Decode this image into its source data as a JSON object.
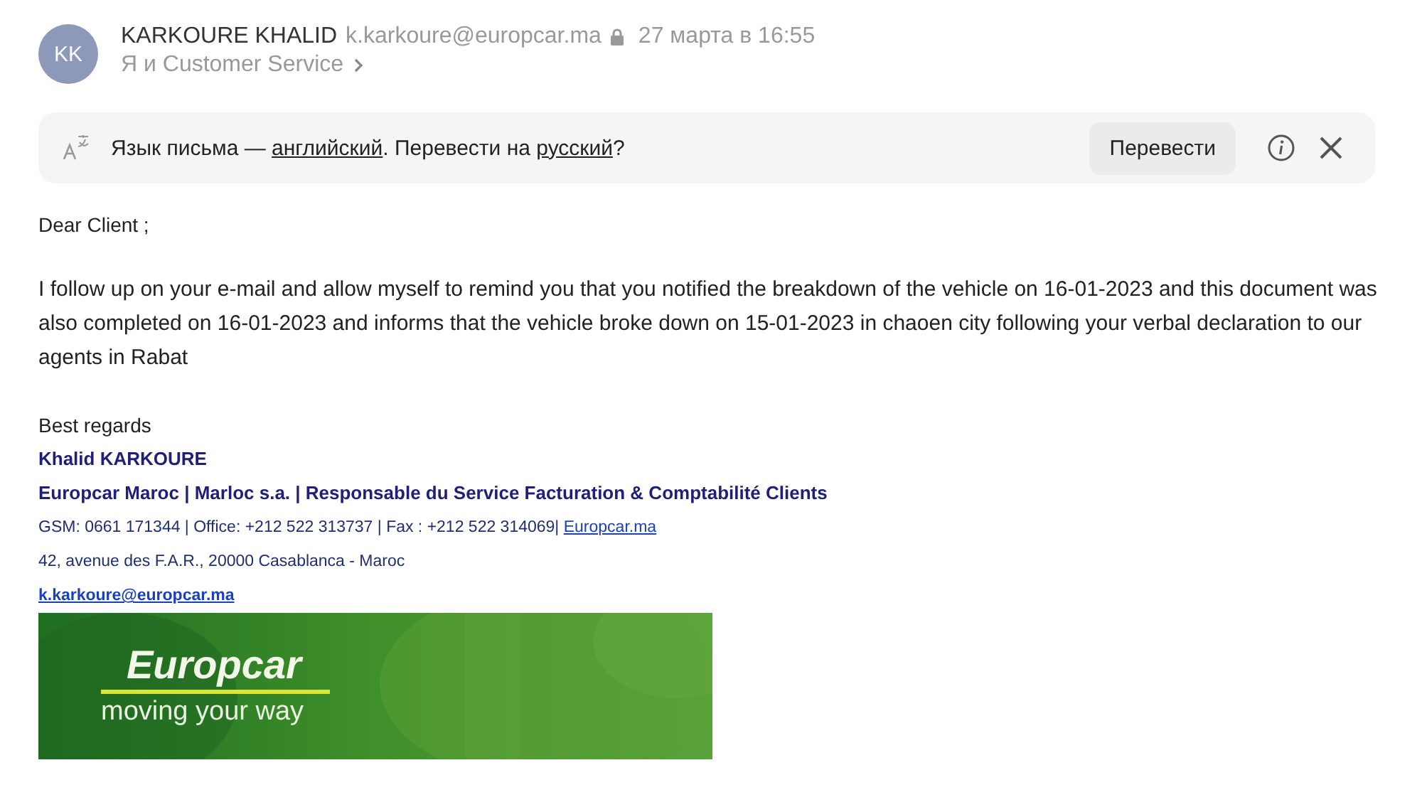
{
  "header": {
    "avatar": "KK",
    "sender_name": "KARKOURE KHALID",
    "sender_email": "k.karkoure@europcar.ma",
    "date": "27 марта в 16:55",
    "recipients": "Я и Customer Service"
  },
  "translate_bar": {
    "prefix": "Язык письма — ",
    "source_language": "английский",
    "middle": ". Перевести на ",
    "target_language": "русский",
    "suffix": "?",
    "button": "Перевести"
  },
  "body": {
    "greeting": "Dear Client ;",
    "paragraph": "I follow up on your e-mail and allow myself to remind you that you notified the breakdown of the vehicle on 16-01-2023 and this document was also completed on 16-01-2023 and informs that the vehicle broke down on 15-01-2023 in chaoen city  following your verbal declaration to our agents in Rabat",
    "closing": "Best regards"
  },
  "signature": {
    "name": "Khalid KARKOURE",
    "title": "Europcar Maroc | Marloc s.a. | Responsable du Service Facturation & Comptabilité Clients",
    "contacts": "GSM: 0661 171344 | Office: +212 522 313737 |  Fax : +212 522 314069|",
    "website": "Europcar.ma",
    "address": "42, avenue des F.A.R., 20000 Casablanca - Maroc",
    "email": "k.karkoure@europcar.ma"
  },
  "banner": {
    "brand": "Europcar",
    "slogan": "moving your way"
  }
}
